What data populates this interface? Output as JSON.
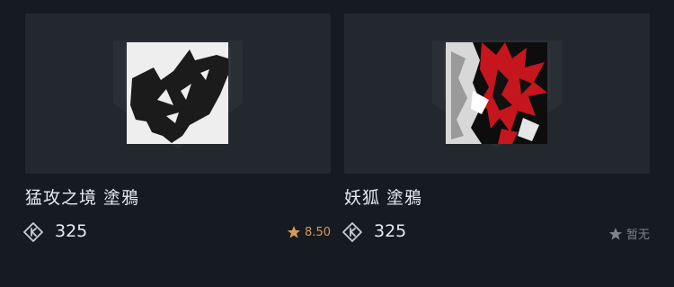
{
  "colors": {
    "background": "#161a21",
    "card_bg": "#23272e",
    "rating_gold": "#d99a5b",
    "rating_grey": "#7d828b"
  },
  "cards": [
    {
      "title": "猛攻之境 塗鴉",
      "price": "325",
      "price_icon": "currency-tag-icon",
      "rating_icon": "star-icon",
      "rating_text": "8.50",
      "rating_state": "rated"
    },
    {
      "title": "妖狐 塗鴉",
      "price": "325",
      "price_icon": "currency-tag-icon",
      "rating_icon": "star-icon",
      "rating_text": "暂无",
      "rating_state": "unrated"
    }
  ]
}
